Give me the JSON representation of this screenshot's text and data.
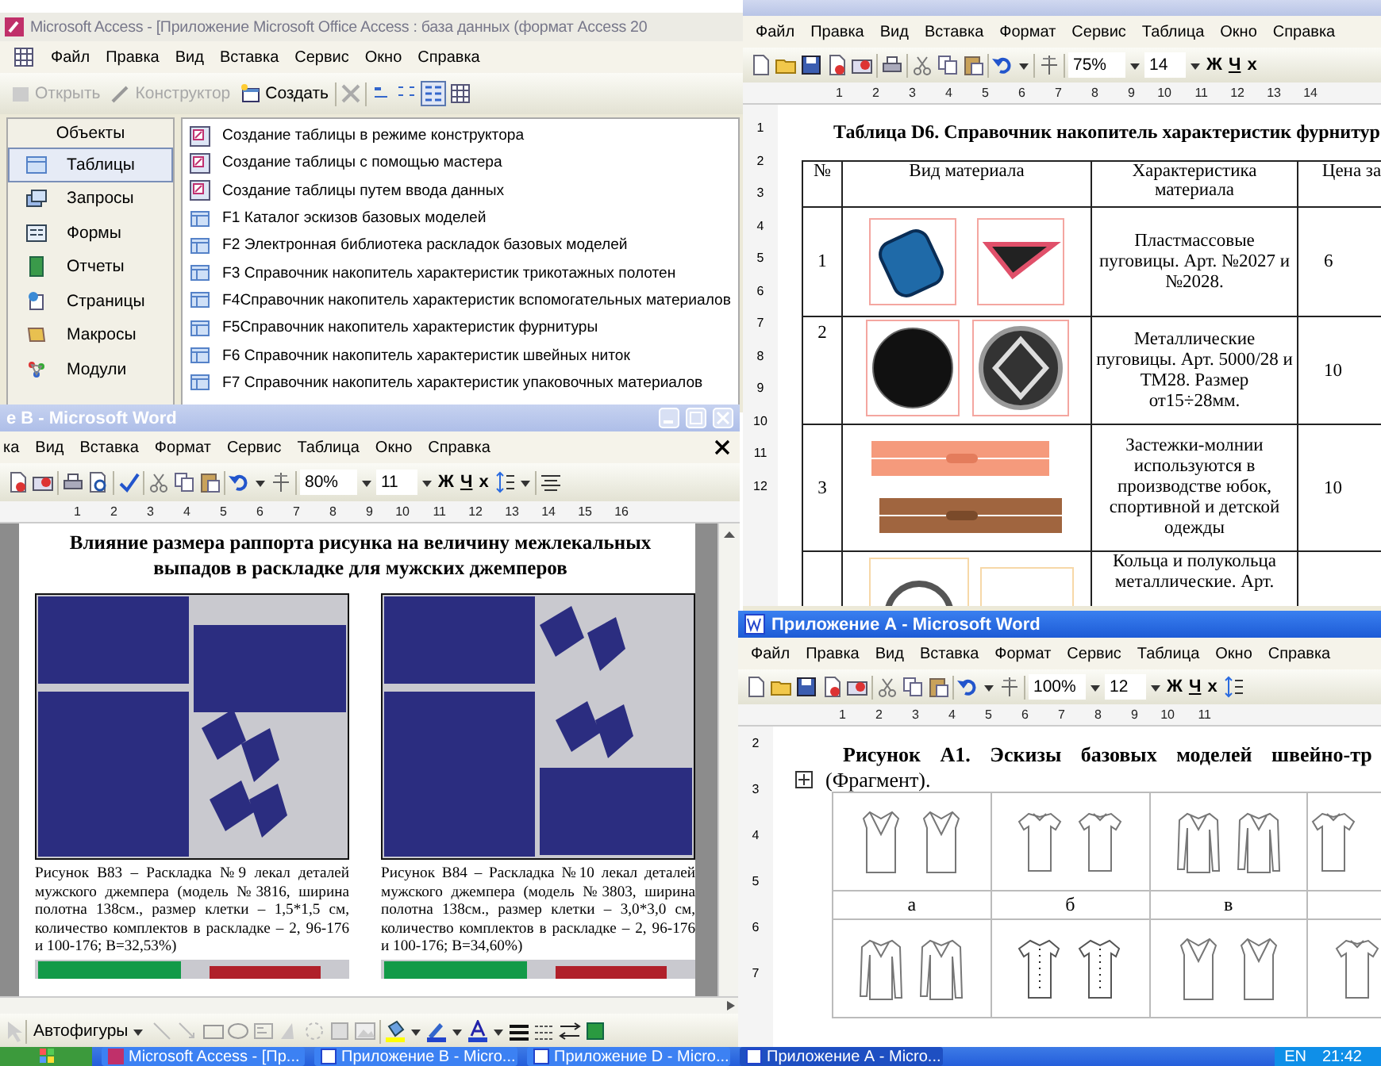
{
  "access_window": {
    "title": "Microsoft Access - [Приложение Microsoft Office Access : база данных (формат Access 20",
    "menu": [
      "Файл",
      "Правка",
      "Вид",
      "Вставка",
      "Сервис",
      "Окно",
      "Справка"
    ],
    "toolbar": [
      {
        "label": "Открыть",
        "disabled": true
      },
      {
        "label": "Конструктор",
        "disabled": true
      },
      {
        "label": "Создать",
        "disabled": false
      }
    ],
    "objects_header": "Объекты",
    "objects": [
      {
        "label": "Таблицы",
        "selected": true
      },
      {
        "label": "Запросы",
        "selected": false
      },
      {
        "label": "Формы",
        "selected": false
      },
      {
        "label": "Отчеты",
        "selected": false
      },
      {
        "label": "Страницы",
        "selected": false
      },
      {
        "label": "Макросы",
        "selected": false
      },
      {
        "label": "Модули",
        "selected": false
      }
    ],
    "items": [
      {
        "kind": "wizard",
        "label": "Создание таблицы в режиме конструктора"
      },
      {
        "kind": "wizard",
        "label": "Создание таблицы с помощью мастера"
      },
      {
        "kind": "wizard",
        "label": "Создание таблицы путем ввода данных"
      },
      {
        "kind": "table",
        "label": "F1 Каталог эскизов базовых моделей"
      },
      {
        "kind": "table",
        "label": "F2 Электронная библиотека раскладок  базовых моделей"
      },
      {
        "kind": "table",
        "label": "F3 Справочник накопитель характеристик трикотажных полотен"
      },
      {
        "kind": "table",
        "label": "F4Справочник накопитель характеристик вспомогательных материалов"
      },
      {
        "kind": "table",
        "label": "F5Справочник накопитель характеристик фурнитуры"
      },
      {
        "kind": "table",
        "label": "F6 Справочник накопитель характеристик швейных ниток"
      },
      {
        "kind": "table",
        "label": "F7 Справочник накопитель характеристик  упаковочных материалов"
      }
    ]
  },
  "word_d": {
    "menu": [
      "Файл",
      "Правка",
      "Вид",
      "Вставка",
      "Формат",
      "Сервис",
      "Таблица",
      "Окно",
      "Справка"
    ],
    "zoom": "75%",
    "font_size": "14",
    "format_buttons": [
      "Ж",
      "Ч",
      "x"
    ],
    "ruler": [
      "1",
      "2",
      "3",
      "4",
      "5",
      "6",
      "7",
      "8",
      "9",
      "10",
      "11",
      "12",
      "13",
      "14"
    ],
    "vruler": [
      "1",
      "2",
      "3",
      "4",
      "5",
      "6",
      "7",
      "8",
      "9",
      "10",
      "11",
      "12"
    ],
    "table_title": "Таблица D6. Справочник накопитель характеристик фурнитур",
    "columns": [
      "№",
      "Вид материала",
      "Характеристика материала",
      "Цена за"
    ],
    "rows": [
      {
        "kind": "buttons_plastic",
        "num": "1",
        "description": "Пластмассовые пуговицы. Арт. №2027 и №2028.",
        "price": "6"
      },
      {
        "kind": "buttons_metal",
        "num": "2",
        "description": "Металлические пуговицы. Арт. 5000/28 и ТМ28. Размер от15÷28мм.",
        "price": "10"
      },
      {
        "kind": "zippers",
        "num": "3",
        "description": "Застежки-молнии используются в производстве юбок, спортивной и детской одежды",
        "price": "10"
      },
      {
        "kind": "rings",
        "description": "Кольца и полукольца металлические. Арт."
      }
    ]
  },
  "word_b": {
    "title": "е B - Microsoft Word",
    "menu": [
      "ка",
      "Вид",
      "Вставка",
      "Формат",
      "Сервис",
      "Таблица",
      "Окно",
      "Справка"
    ],
    "zoom": "80%",
    "font_size": "11",
    "format_buttons": [
      "Ж",
      "Ч",
      "x"
    ],
    "ruler": [
      "1",
      "2",
      "3",
      "4",
      "5",
      "6",
      "7",
      "8",
      "9",
      "10",
      "11",
      "12",
      "13",
      "14",
      "15",
      "16"
    ],
    "heading": "Влияние размера раппорта рисунка на величину межлекальных выпадов в раскладке для мужских джемперов",
    "figures": [
      {
        "caption": "Рисунок В83 – Раскладка №9 лекал деталей  мужского джемпера (модель №3816, ширина полотна 138см., размер клетки – 1,5*1,5 см, количество комплектов в  раскладке – 2, 96-176 и 100-176; В=32,53%)"
      },
      {
        "caption": "Рисунок В84 – Раскладка №10 лекал деталей  мужского джемпера (модель №3803, ширина полотна 138см., размер клетки – 3,0*3,0 см, количество комплектов в раскладке – 2, 96-176 и 100-176; В=34,60%)"
      }
    ],
    "draw_menu": "Автофигуры"
  },
  "word_a": {
    "title": "Приложение А - Microsoft Word",
    "menu": [
      "Файл",
      "Правка",
      "Вид",
      "Вставка",
      "Формат",
      "Сервис",
      "Таблица",
      "Окно",
      "Справка"
    ],
    "zoom": "100%",
    "font_size": "12",
    "format_buttons": [
      "Ж",
      "Ч",
      "x"
    ],
    "ruler": [
      "1",
      "2",
      "3",
      "4",
      "5",
      "6",
      "7",
      "8",
      "9",
      "10",
      "11"
    ],
    "vruler": [
      "2",
      "3",
      "4",
      "5",
      "6",
      "7"
    ],
    "heading": "Рисунок А1. Эскизы базовых моделей швейно-тр",
    "subheading": "(Фрагмент).",
    "labels": [
      "а",
      "б",
      "в"
    ]
  },
  "taskbar": {
    "items": [
      {
        "label": "Microsoft Access - [Пр...",
        "kind": "access",
        "selected": false
      },
      {
        "label": "Приложение B - Micro...",
        "kind": "word",
        "selected": false
      },
      {
        "label": "Приложение D - Micro...",
        "kind": "word",
        "selected": false
      },
      {
        "label": "Приложение А - Micro...",
        "kind": "word",
        "selected": true
      }
    ],
    "language": "EN",
    "clock": "21:42"
  }
}
